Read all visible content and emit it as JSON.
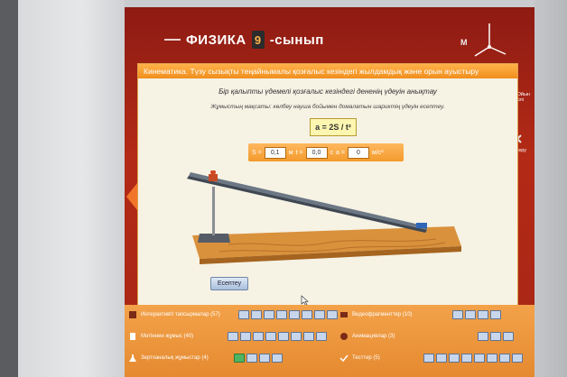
{
  "header": {
    "subject": "ФИЗИКА",
    "grade": "9",
    "grade_suffix": "-сынып",
    "axis_label": "M"
  },
  "window": {
    "title": "Кинематика. Түзу сызықты теңайнымалы қозғалыс кезіндегі жылдамдық және орын ауыстыру",
    "task_title": "Бір қалыпты үдемелі қозғалыс кезіндегі дененің үдеуін анықтау",
    "task_subtitle": "Жұмыстың мақсаты: көлбеу науша бойымен домалатын шариктің үдеуін есептеу.",
    "formula": "a = 2S / t²",
    "params": {
      "s_label": "S =",
      "s_value": "0,1",
      "s_unit": "м",
      "t_label": "t =",
      "t_value": "0,0",
      "t_unit": "с",
      "a_label": "a =",
      "a_value": "0",
      "a_unit": "м/с²"
    },
    "calc_button": "Есептеу"
  },
  "side": {
    "btn1": "Ойын тәсілі",
    "btn2": "Тексеру"
  },
  "bottom": {
    "row1_left": "Интерактивті тапсырмалар (57)",
    "row2_left": "Мәтіннен жұмыс (40)",
    "row3_left": "Зертханалық жұмыстар (4)",
    "row1_right": "Видеофрагменттер (10)",
    "row2_right": "Анимациялар (3)",
    "row3_right": "Тесттер (5)"
  },
  "colors": {
    "accent": "#f39a2c",
    "background": "#a72515"
  }
}
